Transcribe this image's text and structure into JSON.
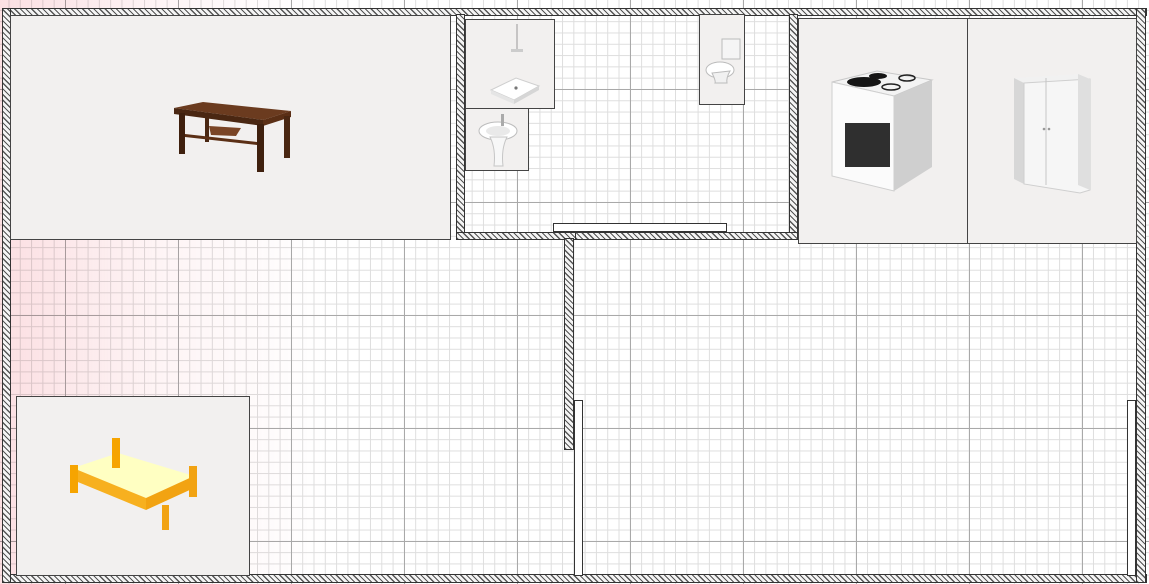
{
  "plan": {
    "wall_color": "#555555",
    "grid_major_color": "#a9a9a9",
    "grid_minor_color": "#dedede",
    "item_card_bg": "#f2f0ef"
  },
  "furniture": [
    {
      "name": "wooden-table",
      "icon": "table-icon"
    },
    {
      "name": "shower-tray",
      "icon": "shower-icon"
    },
    {
      "name": "washbasin",
      "icon": "sink-icon"
    },
    {
      "name": "toilet",
      "icon": "toilet-icon"
    },
    {
      "name": "cooker",
      "icon": "stove-icon"
    },
    {
      "name": "wardrobe",
      "icon": "wardrobe-icon"
    },
    {
      "name": "bed",
      "icon": "bed-icon"
    }
  ]
}
